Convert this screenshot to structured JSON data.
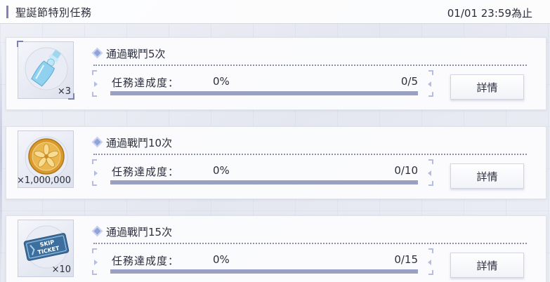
{
  "header": {
    "title": "聖誕節特別任務",
    "deadline": "01/01 23:59為止"
  },
  "missions": [
    {
      "title": "通過戰鬥5次",
      "reward_icon": "ramune-bottle-icon",
      "reward_qty": "×3",
      "progress_label": "任務達成度：",
      "progress_percent": "0%",
      "progress_value": 0,
      "progress_count": "0/5",
      "detail_label": "詳情"
    },
    {
      "title": "通過戰鬥10次",
      "reward_icon": "gold-coin-icon",
      "reward_qty": "×1,000,000",
      "progress_label": "任務達成度：",
      "progress_percent": "0%",
      "progress_value": 0,
      "progress_count": "0/10",
      "detail_label": "詳情"
    },
    {
      "title": "通過戰鬥15次",
      "reward_icon": "skip-ticket-icon",
      "reward_qty": "×10",
      "progress_label": "任務達成度：",
      "progress_percent": "0%",
      "progress_value": 0,
      "progress_count": "0/15",
      "detail_label": "詳情",
      "ticket_text_line1": "SKIP",
      "ticket_text_line2": "TICKET"
    }
  ],
  "colors": {
    "accent": "#7d84b8",
    "progress_track": "#9a9fc4",
    "coin_gold": "#e3a93a",
    "ticket_blue": "#3d6f9e"
  }
}
